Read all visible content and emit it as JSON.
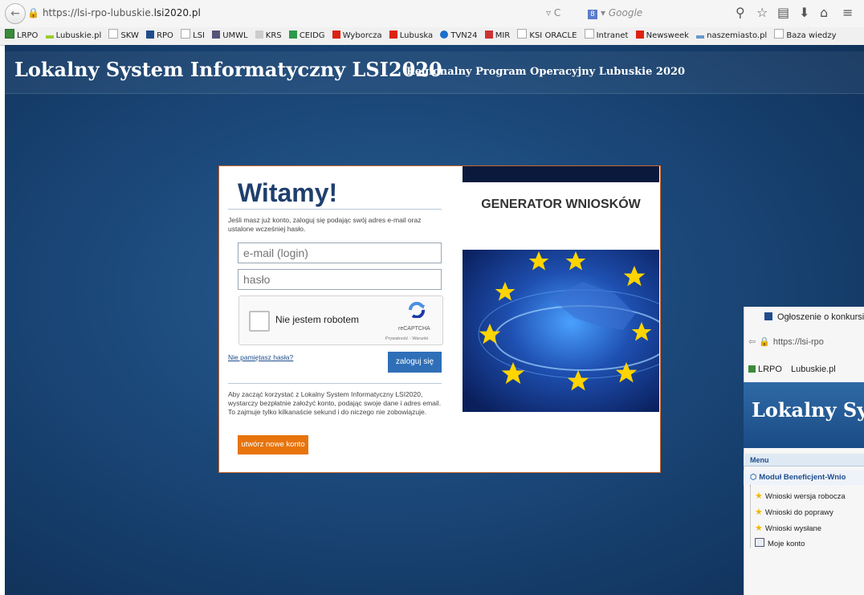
{
  "browser": {
    "url_prefix": "https://lsi-rpo-lubuskie.",
    "url_domain": "lsi2020.pl",
    "search_placeholder": "Google",
    "reload_glyph": "▿ C",
    "bookmarks": [
      "LRPO",
      "Lubuskie.pl",
      "SKW",
      "RPO",
      "LSI",
      "UMWL",
      "KRS",
      "CEIDG",
      "Wyborcza",
      "Lubuska",
      "TVN24",
      "MIR",
      "KSI ORACLE",
      "Intranet",
      "Newsweek",
      "naszemiasto.pl",
      "Baza wiedzy"
    ]
  },
  "header": {
    "title": "Lokalny System Informatyczny LSI2020",
    "subtitle": "Regionalny Program Operacyjny Lubuskie 2020"
  },
  "login": {
    "welcome": "Witamy!",
    "intro": "Jeśli masz już konto, zaloguj się podając swój adres e-mail oraz ustalone wcześniej hasło.",
    "email_placeholder": "e-mail (login)",
    "password_placeholder": "hasło",
    "captcha_label": "Nie jestem robotem",
    "captcha_brand": "reCAPTCHA",
    "captcha_links": "Prywatność - Warunki",
    "forgot_link": "Nie pamiętasz hasła?",
    "login_button": "zaloguj się",
    "register_text": "Aby zacząć korzystać z Lokalny System Informatyczny LSI2020, wystarczy bezpłatnie założyć konto, podając swoje dane i adres email. To zajmuje tylko kilkanaście sekund i do niczego nie zobowiązuje.",
    "register_button": "utwórz nowe konto",
    "generator_title": "GENERATOR WNIOSKÓW"
  },
  "second_window": {
    "tab_title": "Ogłoszenie o konkursi",
    "url": "https://lsi-rpo",
    "bookmarks": [
      "LRPO",
      "Lubuskie.pl"
    ],
    "title": "Lokalny Sy",
    "menu_label": "Menu",
    "module_label": "Moduł Beneficjent-Wnio",
    "items": [
      "Wnioski wersja robocza",
      "Wnioski do poprawy",
      "Wnioski wysłane",
      "Moje konto"
    ]
  },
  "colors": {
    "accent_blue": "#2f6fb8",
    "accent_orange": "#e8740c",
    "title_navy": "#1f3f6e"
  }
}
